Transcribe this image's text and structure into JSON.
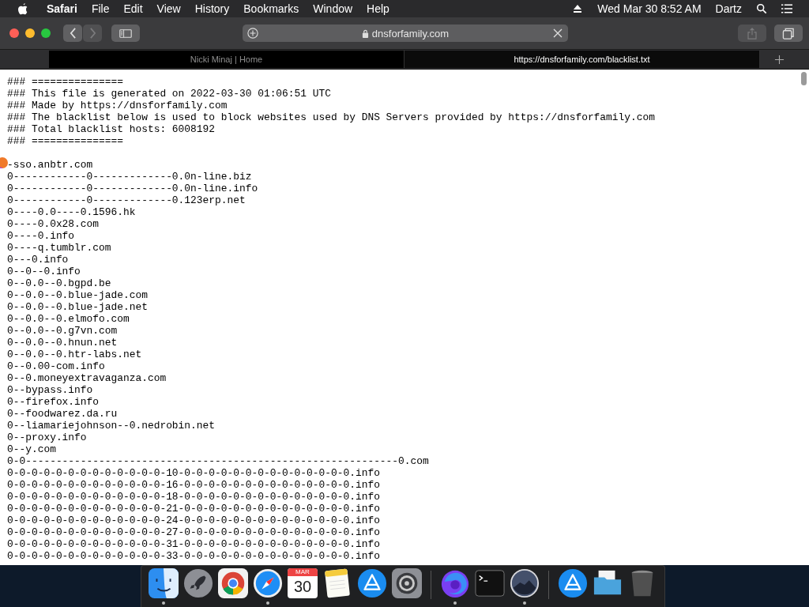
{
  "menu_bar": {
    "app": "Safari",
    "items": [
      "File",
      "Edit",
      "View",
      "History",
      "Bookmarks",
      "Window",
      "Help"
    ],
    "clock": "Wed Mar 30  8:52 AM",
    "user": "Dartz"
  },
  "toolbar": {
    "back_disabled": false,
    "forward_disabled": true,
    "share_disabled": true,
    "address": "dnsforfamily.com"
  },
  "tabs": [
    {
      "label": "Nicki Minaj | Home",
      "selected": false
    },
    {
      "label": "https://dnsforfamily.com/blacklist.txt",
      "selected": true
    }
  ],
  "document": {
    "header": [
      "### ===============",
      "### This file is generated on 2022-03-30 01:06:51 UTC",
      "### Made by https://dnsforfamily.com",
      "### The blacklist below is used to block websites used by DNS Servers provided by https://dnsforfamily.com",
      "### Total blacklist hosts: 6008192",
      "### ==============="
    ],
    "hosts": [
      "-sso.anbtr.com",
      "0------------0-------------0.0n-line.biz",
      "0------------0-------------0.0n-line.info",
      "0------------0-------------0.123erp.net",
      "0----0.0----0.1596.hk",
      "0----0.0x28.com",
      "0----0.info",
      "0----q.tumblr.com",
      "0---0.info",
      "0--0--0.info",
      "0--0.0--0.bgpd.be",
      "0--0.0--0.blue-jade.com",
      "0--0.0--0.blue-jade.net",
      "0--0.0--0.elmofo.com",
      "0--0.0--0.g7vn.com",
      "0--0.0--0.hnun.net",
      "0--0.0--0.htr-labs.net",
      "0--0.00-com.info",
      "0--0.moneyextravaganza.com",
      "0--bypass.info",
      "0--firefox.info",
      "0--foodwarez.da.ru",
      "0--liamariejohnson--0.nedrobin.net",
      "0--proxy.info",
      "0--y.com",
      "0-0-------------------------------------------------------------0.com",
      "0-0-0-0-0-0-0-0-0-0-0-0-0-10-0-0-0-0-0-0-0-0-0-0-0-0-0-0.info",
      "0-0-0-0-0-0-0-0-0-0-0-0-0-16-0-0-0-0-0-0-0-0-0-0-0-0-0-0.info",
      "0-0-0-0-0-0-0-0-0-0-0-0-0-18-0-0-0-0-0-0-0-0-0-0-0-0-0-0.info",
      "0-0-0-0-0-0-0-0-0-0-0-0-0-21-0-0-0-0-0-0-0-0-0-0-0-0-0-0.info",
      "0-0-0-0-0-0-0-0-0-0-0-0-0-24-0-0-0-0-0-0-0-0-0-0-0-0-0-0.info",
      "0-0-0-0-0-0-0-0-0-0-0-0-0-27-0-0-0-0-0-0-0-0-0-0-0-0-0-0.info",
      "0-0-0-0-0-0-0-0-0-0-0-0-0-31-0-0-0-0-0-0-0-0-0-0-0-0-0-0.info",
      "0-0-0-0-0-0-0-0-0-0-0-0-0-33-0-0-0-0-0-0-0-0-0-0-0-0-0-0.info"
    ]
  },
  "dock": [
    {
      "kind": "finder",
      "running": true
    },
    {
      "kind": "launchpad",
      "running": false
    },
    {
      "kind": "chrome",
      "running": false
    },
    {
      "kind": "safari",
      "running": true
    },
    {
      "kind": "calendar",
      "running": false,
      "month": "MAR",
      "day": "30"
    },
    {
      "kind": "notes",
      "running": false
    },
    {
      "kind": "appstore",
      "running": false
    },
    {
      "kind": "settings",
      "running": false
    },
    {
      "kind": "divider"
    },
    {
      "kind": "firefox",
      "running": true
    },
    {
      "kind": "terminal",
      "running": false
    },
    {
      "kind": "installer",
      "running": true
    },
    {
      "kind": "divider"
    },
    {
      "kind": "downloads",
      "running": false
    },
    {
      "kind": "folder",
      "running": false
    },
    {
      "kind": "trash",
      "running": false
    }
  ]
}
